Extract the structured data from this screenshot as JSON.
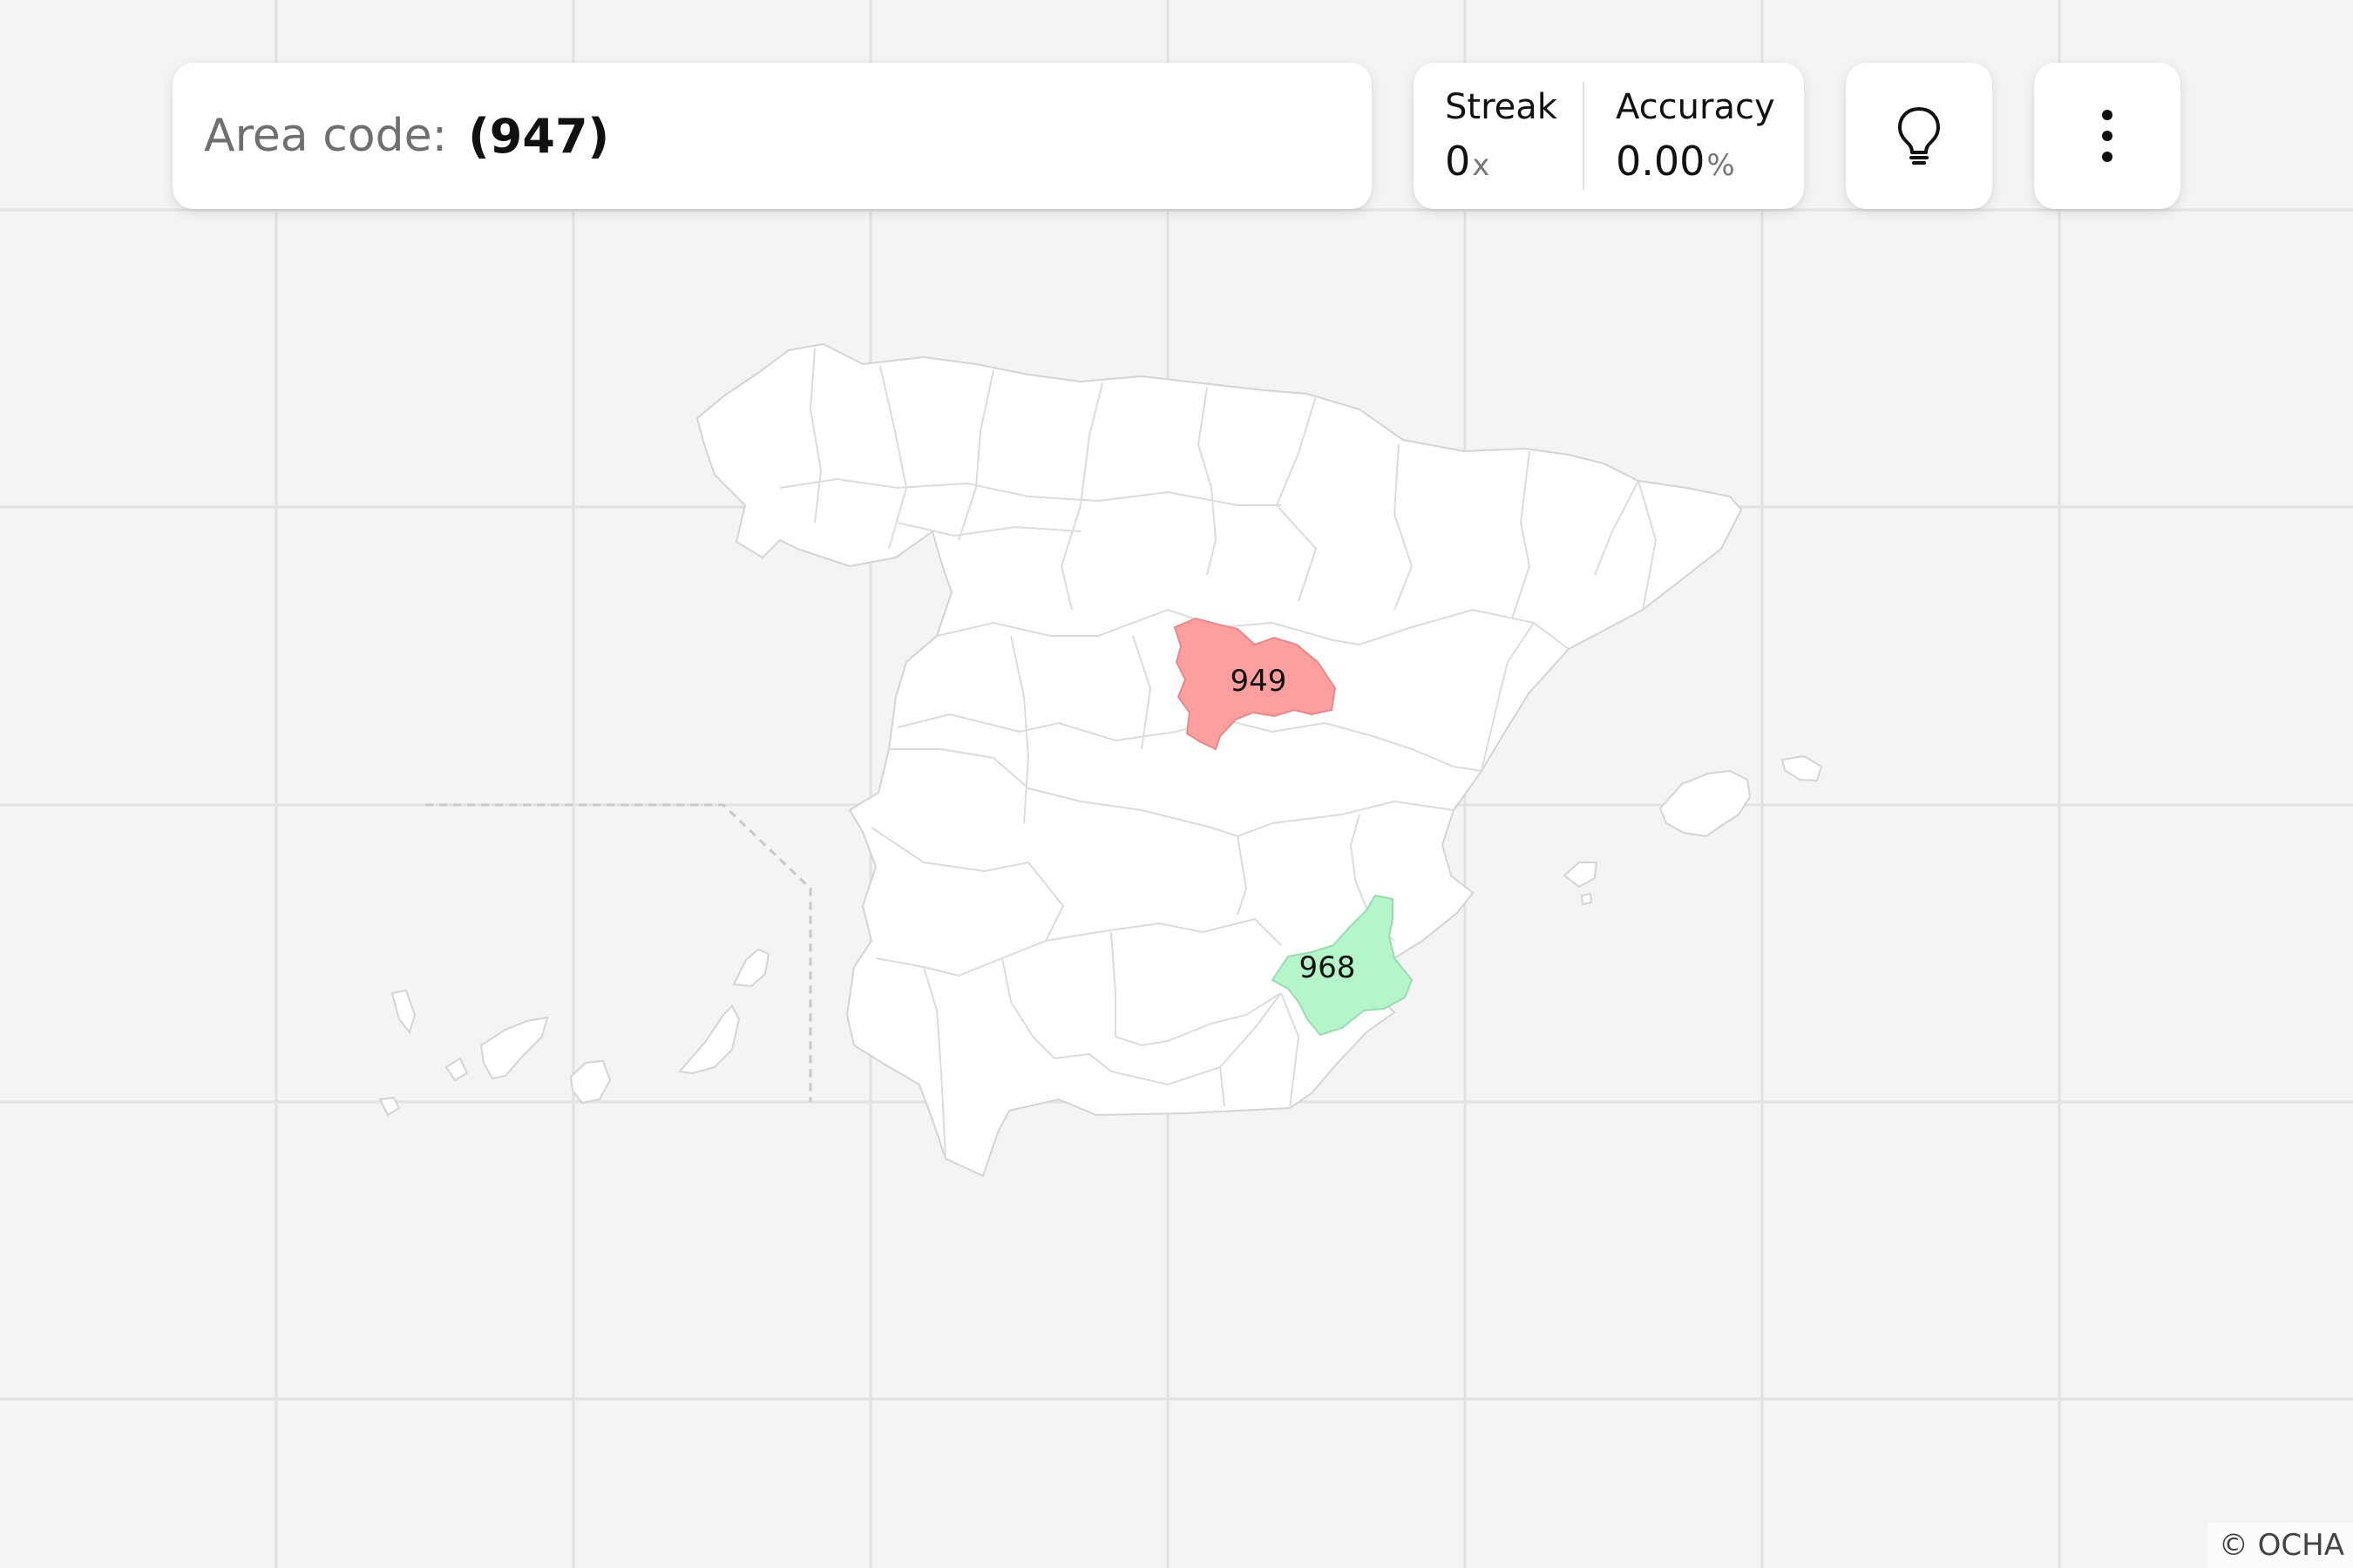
{
  "prompt": {
    "label": "Area code:",
    "value": "(947)"
  },
  "stats": {
    "streak": {
      "label": "Streak",
      "value": "0",
      "unit": "x"
    },
    "accuracy": {
      "label": "Accuracy",
      "value": "0.00",
      "unit": "%"
    }
  },
  "toolbar": {
    "hint_icon": "lightbulb-icon",
    "menu_icon": "more-vertical-icon"
  },
  "map": {
    "country": "Spain",
    "highlighted_regions": [
      {
        "label": "949",
        "state": "incorrect",
        "color": "#ff9e9e"
      },
      {
        "label": "968",
        "state": "correct",
        "color": "#b4f5c9"
      }
    ],
    "colors": {
      "background": "#f4f4f4",
      "land": "#ffffff",
      "border": "#d4d4d4"
    }
  },
  "attribution": "© OCHA"
}
